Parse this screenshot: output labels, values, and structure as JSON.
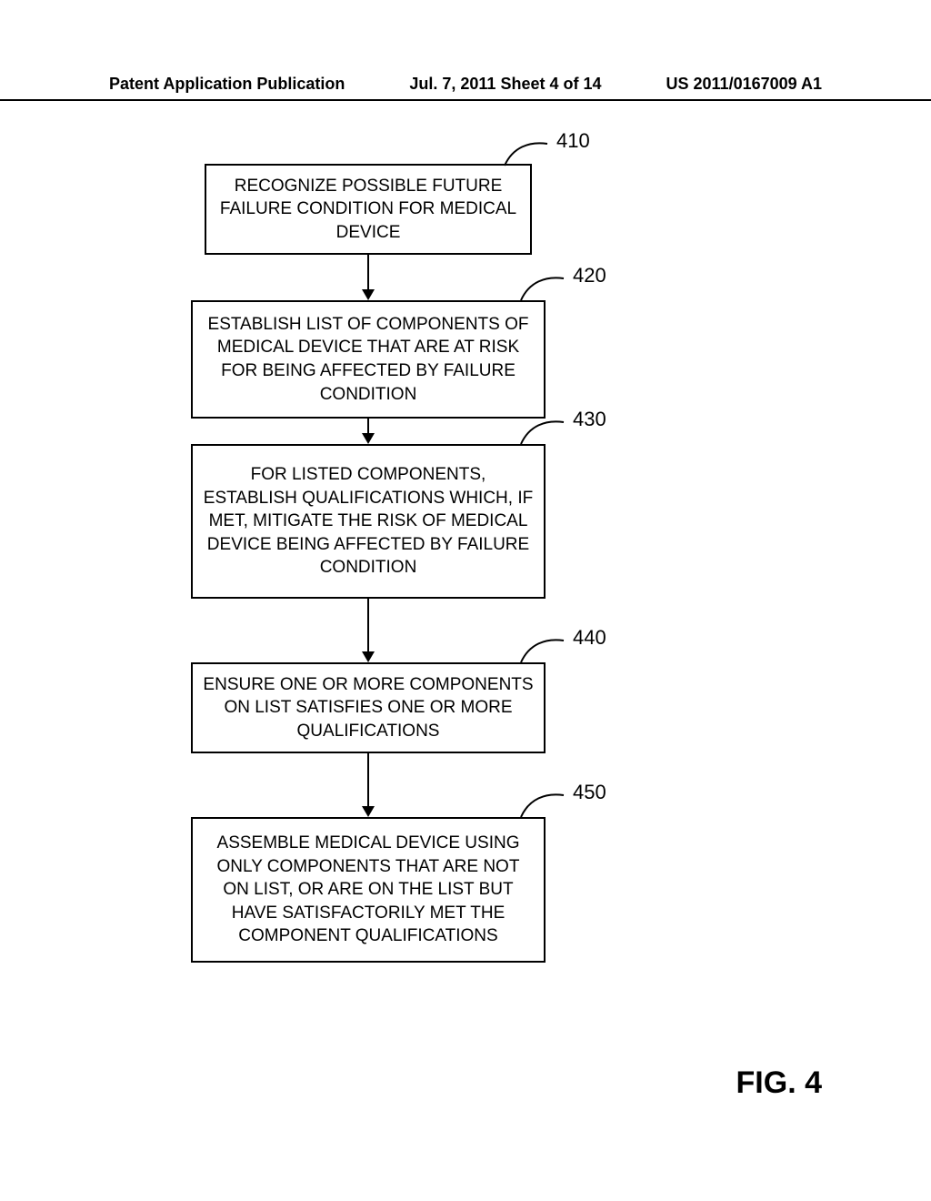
{
  "header": {
    "left": "Patent Application Publication",
    "center": "Jul. 7, 2011   Sheet 4 of 14",
    "right": "US 2011/0167009 A1"
  },
  "chart_data": {
    "type": "flowchart",
    "direction": "top-to-bottom",
    "nodes": [
      {
        "id": "410",
        "label": "RECOGNIZE POSSIBLE FUTURE FAILURE CONDITION FOR MEDICAL DEVICE"
      },
      {
        "id": "420",
        "label": "ESTABLISH LIST OF COMPONENTS OF MEDICAL DEVICE THAT ARE AT RISK FOR BEING AFFECTED BY FAILURE CONDITION"
      },
      {
        "id": "430",
        "label": "FOR LISTED COMPONENTS, ESTABLISH QUALIFICATIONS WHICH, IF MET, MITIGATE THE RISK OF MEDICAL DEVICE BEING AFFECTED BY FAILURE CONDITION"
      },
      {
        "id": "440",
        "label": "ENSURE ONE OR MORE COMPONENTS ON LIST SATISFIES ONE OR MORE QUALIFICATIONS"
      },
      {
        "id": "450",
        "label": "ASSEMBLE MEDICAL DEVICE USING ONLY COMPONENTS THAT ARE NOT ON LIST, OR ARE ON THE LIST BUT HAVE SATISFACTORILY MET THE COMPONENT QUALIFICATIONS"
      }
    ],
    "edges": [
      {
        "from": "410",
        "to": "420"
      },
      {
        "from": "420",
        "to": "430"
      },
      {
        "from": "430",
        "to": "440"
      },
      {
        "from": "440",
        "to": "450"
      }
    ],
    "figure_label": "FIG. 4"
  }
}
